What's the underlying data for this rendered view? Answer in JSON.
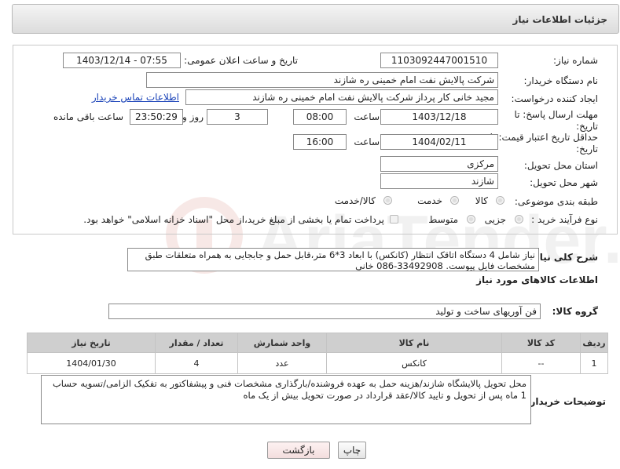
{
  "header": {
    "title": "جزئیات اطلاعات نیاز"
  },
  "form": {
    "need_number_label": "شماره نیاز:",
    "need_number": "1103092447001510",
    "announce_label": "تاریخ و ساعت اعلان عمومی:",
    "announce_value": "1403/12/14 - 07:55",
    "buyer_label": "نام دستگاه خریدار:",
    "buyer_value": "شرکت پالایش نفت امام خمینی  ره  شازند",
    "creator_label": "ایجاد کننده درخواست:",
    "creator_value": "مجید خانی کار پرداز شرکت پالایش نفت امام خمینی  ره  شازند",
    "contact_link": "اطلاعات تماس خریدار",
    "deadline_label": "مهلت ارسال پاسخ: تا تاریخ:",
    "deadline_date": "1403/12/18",
    "time_label": "ساعت",
    "deadline_time": "08:00",
    "days_value": "3",
    "days_label": "روز و",
    "remaining_time": "23:50:29",
    "remaining_label": "ساعت باقی مانده",
    "validity_label": "حداقل تاریخ اعتبار قیمت: تا تاریخ:",
    "validity_date": "1404/02/11",
    "validity_time": "16:00",
    "province_label": "استان محل تحویل:",
    "province_value": "مرکزی",
    "city_label": "شهر محل تحویل:",
    "city_value": "شازند",
    "category_label": "طبقه بندی موضوعی:",
    "category_options": [
      "کالا",
      "خدمت",
      "کالا/خدمت"
    ],
    "process_label": "نوع فرآیند خرید :",
    "process_options": [
      "جزیی",
      "متوسط"
    ],
    "payment_note": "پرداخت تمام یا بخشی از مبلغ خرید،از محل \"اسناد خزانه اسلامی\" خواهد بود."
  },
  "description": {
    "label": "شرح کلی نیاز:",
    "text": "نیاز شامل 4 دستگاه اتاقک انتظار (کانکس) با ابعاد 3*6 متر،قابل حمل و جابجایی به همراه متعلقات طبق مشخصات فایل پیوست. 33492908-086 خانی"
  },
  "goods": {
    "section_title": "اطلاعات کالاهای مورد نیاز",
    "group_label": "گروه کالا:",
    "group_value": "فن آوریهای ساخت و تولید",
    "columns": [
      "ردیف",
      "کد کالا",
      "نام کالا",
      "واحد شمارش",
      "تعداد / مقدار",
      "تاریخ نیاز"
    ],
    "rows": [
      {
        "row": "1",
        "code": "--",
        "name": "کانکس",
        "unit": "عدد",
        "qty": "4",
        "date": "1404/01/30"
      }
    ]
  },
  "buyer_notes": {
    "label": "توضیحات خریدار:",
    "text": "محل تحویل پالایشگاه شازند/هزینه حمل به عهده فروشنده/بارگذاری مشخصات فنی و پیشفاکتور به تفکیک الزامی/تسویه حساب 1 ماه پس از تحویل و تایید کالا/عقد قرارداد در صورت تحویل بیش از یک ماه"
  },
  "buttons": {
    "back": "بازگشت",
    "print": "چاپ"
  },
  "colors": {
    "link": "#1a43b8",
    "back_button": "#f7e4e4"
  }
}
